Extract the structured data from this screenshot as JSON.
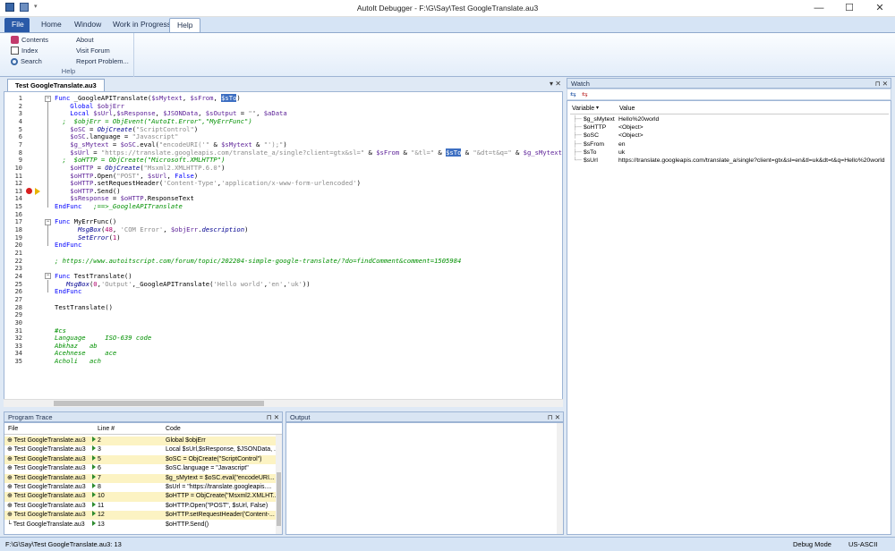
{
  "window": {
    "title": "AutoIt Debugger - F:\\G\\Say\\Test GoogleTranslate.au3",
    "minimize": "—",
    "maximize": "☐",
    "close": "✕"
  },
  "menu": {
    "tabs": [
      "File",
      "Home",
      "Window",
      "Work in Progress",
      "Help"
    ]
  },
  "ribbon": {
    "items_left": [
      "Contents",
      "Index",
      "Search"
    ],
    "items_right": [
      "About",
      "Visit Forum",
      "Report Problem..."
    ],
    "group_label": "Help"
  },
  "editor": {
    "tab_label": "Test GoogleTranslate.au3",
    "lines": [
      [
        [
          "kw",
          "Func "
        ],
        [
          "",
          "_GoogleAPITranslate("
        ],
        [
          "var",
          "$sMytext"
        ],
        [
          "",
          ", "
        ],
        [
          "var",
          "$sFrom"
        ],
        [
          "",
          ", "
        ],
        [
          "hl",
          "$sTo"
        ],
        [
          "",
          ")"
        ]
      ],
      [
        [
          "kw",
          "    Global "
        ],
        [
          "var",
          "$objErr"
        ]
      ],
      [
        [
          "kw",
          "    Local "
        ],
        [
          "var",
          "$sUrl"
        ],
        [
          "",
          ","
        ],
        [
          "var",
          "$sResponse"
        ],
        [
          "",
          ", "
        ],
        [
          "var",
          "$JSONData"
        ],
        [
          "",
          ", "
        ],
        [
          "var",
          "$sOutput"
        ],
        [
          "",
          " = "
        ],
        [
          "str",
          "\"\""
        ],
        [
          "",
          ", "
        ],
        [
          "var",
          "$aData"
        ]
      ],
      [
        [
          "cmt",
          "  ;  $objErr = ObjEvent(\"AutoIt.Error\",\"MyErrFunc\")"
        ]
      ],
      [
        [
          "var",
          "    $oSC"
        ],
        [
          "",
          " = "
        ],
        [
          "fn",
          "ObjCreate"
        ],
        [
          "",
          "("
        ],
        [
          "str",
          "\"ScriptControl\""
        ],
        [
          "",
          ")"
        ]
      ],
      [
        [
          "var",
          "    $oSC"
        ],
        [
          "",
          ".language = "
        ],
        [
          "str",
          "\"Javascript\""
        ]
      ],
      [
        [
          "var",
          "    $g_sMytext"
        ],
        [
          "",
          " = "
        ],
        [
          "var",
          "$oSC"
        ],
        [
          "",
          ".eval("
        ],
        [
          "str",
          "\"encodeURI('\""
        ],
        [
          "",
          " & "
        ],
        [
          "var",
          "$sMytext"
        ],
        [
          "",
          " & "
        ],
        [
          "str",
          "\"');\""
        ],
        [
          "",
          ")"
        ]
      ],
      [
        [
          "var",
          "    $sUrl"
        ],
        [
          "",
          " = "
        ],
        [
          "str",
          "\"https://translate.googleapis.com/translate_a/single?client=gtx&sl=\""
        ],
        [
          "",
          " & "
        ],
        [
          "var",
          "$sFrom"
        ],
        [
          "",
          " & "
        ],
        [
          "str",
          "\"&tl=\""
        ],
        [
          "",
          " & "
        ],
        [
          "hl",
          "$sTo"
        ],
        [
          "",
          " & "
        ],
        [
          "str",
          "\"&dt=t&q=\""
        ],
        [
          "",
          " & "
        ],
        [
          "var",
          "$g_sMytext"
        ]
      ],
      [
        [
          "cmt",
          "  ;  $oHTTP = ObjCreate(\"Microsoft.XMLHTTP\")"
        ]
      ],
      [
        [
          "var",
          "    $oHTTP"
        ],
        [
          "",
          " = "
        ],
        [
          "fn",
          "ObjCreate"
        ],
        [
          "",
          "("
        ],
        [
          "str",
          "\"Msxml2.XMLHTTP.6.0\""
        ],
        [
          "",
          ")"
        ]
      ],
      [
        [
          "var",
          "    $oHTTP"
        ],
        [
          "",
          ".Open("
        ],
        [
          "str",
          "\"POST\""
        ],
        [
          "",
          ", "
        ],
        [
          "var",
          "$sUrl"
        ],
        [
          "",
          ", "
        ],
        [
          "kw",
          "False"
        ],
        [
          "",
          ")"
        ]
      ],
      [
        [
          "var",
          "    $oHTTP"
        ],
        [
          "",
          ".setRequestHeader("
        ],
        [
          "str",
          "'Content-Type'"
        ],
        [
          "",
          ","
        ],
        [
          "str",
          "'application/x-www-form-urlencoded'"
        ],
        [
          "",
          ")"
        ]
      ],
      [
        [
          "var",
          "    $oHTTP"
        ],
        [
          "",
          ".Send()"
        ]
      ],
      [
        [
          "var",
          "    $sResponse"
        ],
        [
          "",
          " = "
        ],
        [
          "var",
          "$oHTTP"
        ],
        [
          "",
          ".ResponseText"
        ]
      ],
      [
        [
          "kw",
          "EndFunc"
        ],
        [
          "cmt",
          "   ;==>_GoogleAPITranslate"
        ]
      ],
      [
        [
          "",
          ""
        ]
      ],
      [
        [
          "kw",
          "Func "
        ],
        [
          "",
          "MyErrFunc()"
        ]
      ],
      [
        [
          "fn",
          "      MsgBox"
        ],
        [
          "",
          "("
        ],
        [
          "num",
          "48"
        ],
        [
          "",
          ", "
        ],
        [
          "str",
          "'COM Error'"
        ],
        [
          "",
          ", "
        ],
        [
          "var",
          "$objErr"
        ],
        [
          "",
          "."
        ],
        [
          "fn",
          "description"
        ],
        [
          "",
          ")"
        ]
      ],
      [
        [
          "fn",
          "      SetError"
        ],
        [
          "",
          "("
        ],
        [
          "num",
          "1"
        ],
        [
          "",
          ")"
        ]
      ],
      [
        [
          "kw",
          "EndFunc"
        ]
      ],
      [
        [
          "",
          ""
        ]
      ],
      [
        [
          "cmt",
          "; https://www.autoitscript.com/forum/topic/202204-simple-google-translate/?do=findComment&comment=1505984"
        ]
      ],
      [
        [
          "",
          ""
        ]
      ],
      [
        [
          "kw",
          "Func "
        ],
        [
          "",
          "TestTranslate()"
        ]
      ],
      [
        [
          "fn",
          "   MsgBox"
        ],
        [
          "",
          "("
        ],
        [
          "num",
          "0"
        ],
        [
          "",
          ","
        ],
        [
          "str",
          "'Output'"
        ],
        [
          "",
          ",_GoogleAPITranslate("
        ],
        [
          "str",
          "'Hello world'"
        ],
        [
          "",
          ","
        ],
        [
          "str",
          "'en'"
        ],
        [
          "",
          ","
        ],
        [
          "str",
          "'uk'"
        ],
        [
          "",
          "))"
        ]
      ],
      [
        [
          "kw",
          "EndFunc"
        ]
      ],
      [
        [
          "",
          ""
        ]
      ],
      [
        [
          "",
          "TestTranslate()"
        ]
      ],
      [
        [
          "",
          ""
        ]
      ],
      [
        [
          "",
          ""
        ]
      ],
      [
        [
          "cmt",
          "#cs"
        ]
      ],
      [
        [
          "cmt",
          "Language     ISO-639 code"
        ]
      ],
      [
        [
          "cmt",
          "Abkhaz   ab"
        ]
      ],
      [
        [
          "cmt",
          "Acehnese     ace"
        ]
      ],
      [
        [
          "cmt",
          "Acholi   ach"
        ]
      ]
    ]
  },
  "trace": {
    "title": "Program Trace",
    "columns": [
      "File",
      "Line #",
      "Code"
    ],
    "rows": [
      {
        "file": "Test GoogleTranslate.au3",
        "line": "2",
        "code": "Global $objErr"
      },
      {
        "file": "Test GoogleTranslate.au3",
        "line": "3",
        "code": "Local $sUrl,$sResponse, $JSONData, ..."
      },
      {
        "file": "Test GoogleTranslate.au3",
        "line": "5",
        "code": "$oSC = ObjCreate(\"ScriptControl\")"
      },
      {
        "file": "Test GoogleTranslate.au3",
        "line": "6",
        "code": "$oSC.language = \"Javascript\""
      },
      {
        "file": "Test GoogleTranslate.au3",
        "line": "7",
        "code": "$g_sMytext = $oSC.eval(\"encodeURI..."
      },
      {
        "file": "Test GoogleTranslate.au3",
        "line": "8",
        "code": "$sUrl = \"https://translate.googleapis...."
      },
      {
        "file": "Test GoogleTranslate.au3",
        "line": "10",
        "code": "$oHTTP = ObjCreate(\"Msxml2.XMLHT..."
      },
      {
        "file": "Test GoogleTranslate.au3",
        "line": "11",
        "code": "$oHTTP.Open(\"POST\", $sUrl, False)"
      },
      {
        "file": "Test GoogleTranslate.au3",
        "line": "12",
        "code": "$oHTTP.setRequestHeader('Content-..."
      },
      {
        "file": "Test GoogleTranslate.au3",
        "line": "13",
        "code": "$oHTTP.Send()"
      }
    ]
  },
  "output": {
    "title": "Output"
  },
  "watch": {
    "title": "Watch",
    "columns": [
      "Variable",
      "Value"
    ],
    "rows": [
      {
        "name": "$g_sMytext",
        "value": "Hello%20world"
      },
      {
        "name": "$oHTTP",
        "value": "<Object>"
      },
      {
        "name": "$oSC",
        "value": "<Object>"
      },
      {
        "name": "$sFrom",
        "value": "en"
      },
      {
        "name": "$sTo",
        "value": "uk"
      },
      {
        "name": "$sUrl",
        "value": "https://translate.googleapis.com/translate_a/single?client=gtx&sl=en&tl=uk&dt=t&q=Hello%20world"
      }
    ]
  },
  "status": {
    "path": "F:\\G\\Say\\Test GoogleTranslate.au3: 13",
    "mode": "Debug Mode",
    "encoding": "US-ASCII"
  }
}
